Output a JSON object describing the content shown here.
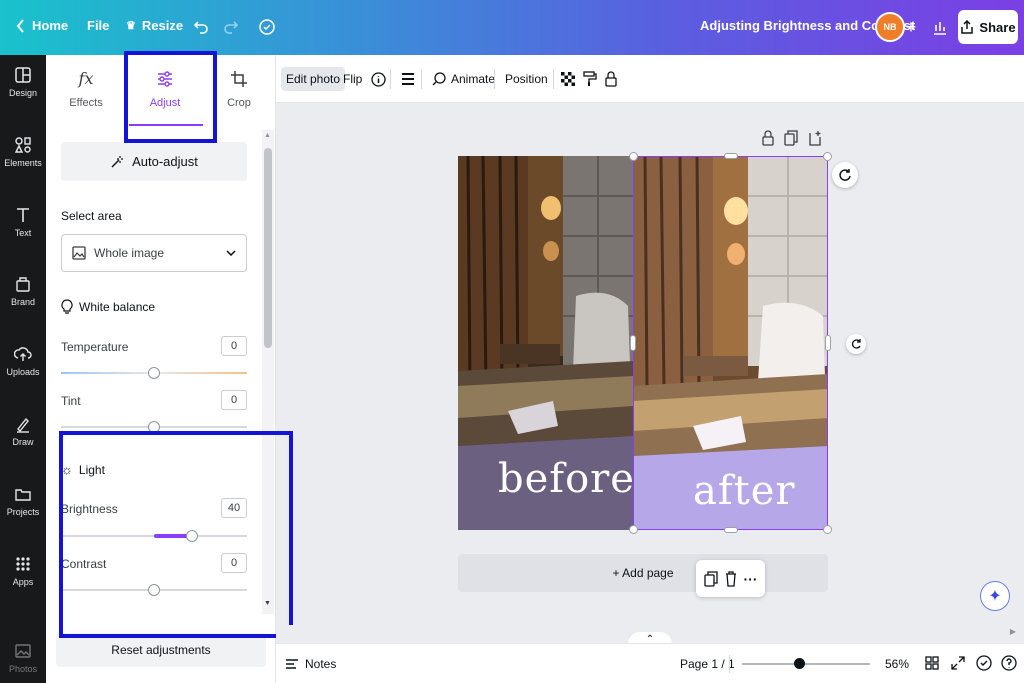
{
  "topbar": {
    "home_label": "Home",
    "file_label": "File",
    "resize_label": "Resize",
    "document_title": "Adjusting Brightness and Contrast",
    "avatar_initials": "NB",
    "share_label": "Share"
  },
  "rail": {
    "items": [
      {
        "label": "Design",
        "icon": "design-icon"
      },
      {
        "label": "Elements",
        "icon": "elements-icon"
      },
      {
        "label": "Text",
        "icon": "text-icon"
      },
      {
        "label": "Brand",
        "icon": "brand-icon"
      },
      {
        "label": "Uploads",
        "icon": "uploads-icon"
      },
      {
        "label": "Draw",
        "icon": "draw-icon"
      },
      {
        "label": "Projects",
        "icon": "projects-icon"
      },
      {
        "label": "Apps",
        "icon": "apps-icon"
      },
      {
        "label": "Photos",
        "icon": "photos-icon"
      }
    ]
  },
  "panel": {
    "tabs": [
      {
        "label": "Effects"
      },
      {
        "label": "Adjust"
      },
      {
        "label": "Crop"
      }
    ],
    "auto_adjust_label": "Auto-adjust",
    "select_area_label": "Select area",
    "select_area_value": "Whole image",
    "white_balance_label": "White balance",
    "temperature": {
      "label": "Temperature",
      "value": "0",
      "level": 0.5
    },
    "tint": {
      "label": "Tint",
      "value": "0",
      "level": 0.5
    },
    "light_label": "Light",
    "brightness": {
      "label": "Brightness",
      "value": "40",
      "level": 0.7
    },
    "contrast": {
      "label": "Contrast",
      "value": "0",
      "level": 0.5
    },
    "reset_label": "Reset adjustments"
  },
  "toolbar": {
    "edit_photo": "Edit photo",
    "flip": "Flip",
    "animate": "Animate",
    "position": "Position"
  },
  "canvas": {
    "before_caption": "before",
    "after_caption": "after",
    "add_page_label": "+ Add page"
  },
  "bottombar": {
    "notes_label": "Notes",
    "page_indicator": "Page 1 / 1",
    "zoom_label": "56%",
    "zoom_level": 0.56
  },
  "colors": {
    "accent": "#8b3dff",
    "highlight": "#1414d6"
  }
}
